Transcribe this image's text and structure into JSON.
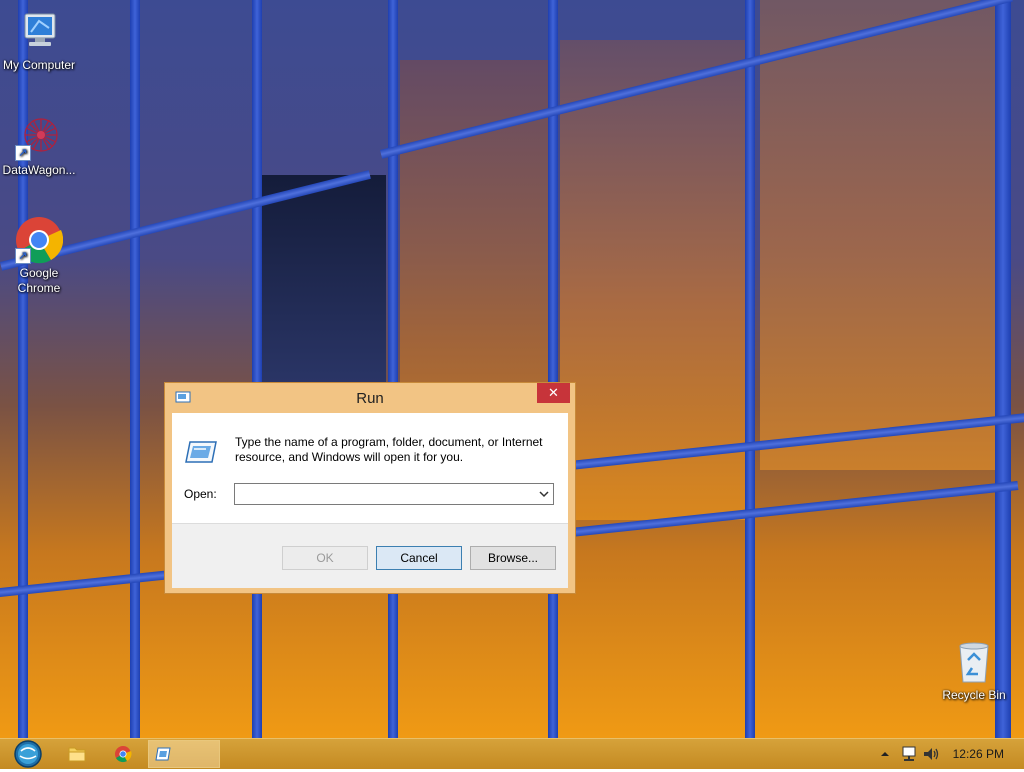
{
  "desktop": {
    "icons": [
      {
        "label": "My Computer",
        "icon": "computer-icon"
      },
      {
        "label": "DataWagon...",
        "icon": "datawagon-icon"
      },
      {
        "label": "Google Chrome",
        "icon": "chrome-icon"
      },
      {
        "label": "Recycle Bin",
        "icon": "recycle-bin-icon"
      }
    ]
  },
  "run_dialog": {
    "title": "Run",
    "close_glyph": "✕",
    "description": "Type the name of a program, folder, document, or Internet resource, and Windows will open it for you.",
    "open_label": "Open:",
    "open_value": "",
    "buttons": {
      "ok": "OK",
      "cancel": "Cancel",
      "browse": "Browse..."
    }
  },
  "taskbar": {
    "pinned": [
      "file-explorer-icon",
      "chrome-icon"
    ],
    "active_window_icon": "run-icon",
    "tray_icons": [
      "show-hidden-icons-chevron",
      "network-icon",
      "volume-icon"
    ],
    "clock": "12:26 PM"
  },
  "colors": {
    "dialog_frame": "#f2c484",
    "close_button": "#c7343a",
    "taskbar": "#c48a22"
  }
}
